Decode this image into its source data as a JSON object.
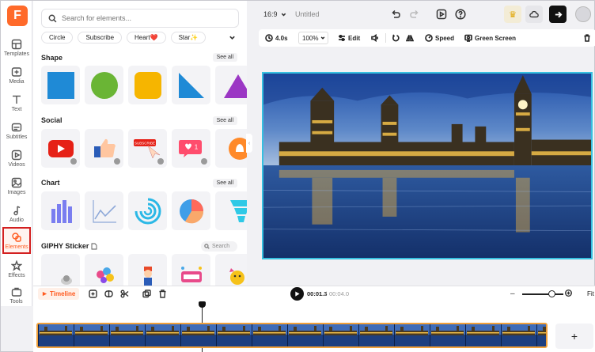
{
  "app": {
    "logo_letter": "F"
  },
  "rail": [
    {
      "label": "Templates",
      "icon": "templates-icon"
    },
    {
      "label": "Media",
      "icon": "media-icon"
    },
    {
      "label": "Text",
      "icon": "text-icon"
    },
    {
      "label": "Subtitles",
      "icon": "subtitles-icon"
    },
    {
      "label": "Videos",
      "icon": "videos-icon"
    },
    {
      "label": "Images",
      "icon": "images-icon"
    },
    {
      "label": "Audio",
      "icon": "audio-icon"
    },
    {
      "label": "Elements",
      "icon": "elements-icon",
      "active": true
    },
    {
      "label": "Effects",
      "icon": "effects-icon"
    },
    {
      "label": "Tools",
      "icon": "tools-icon"
    }
  ],
  "panel": {
    "search_placeholder": "Search for elements...",
    "chips": [
      "Circle",
      "Subscribe",
      "Heart❤️",
      "Star✨"
    ],
    "sections": {
      "shape": {
        "title": "Shape",
        "see_all": "See all"
      },
      "social": {
        "title": "Social",
        "see_all": "See all",
        "notification_count": "1",
        "subscribe_text": "SUBSCRIBE"
      },
      "chart": {
        "title": "Chart",
        "see_all": "See all"
      },
      "giphy": {
        "title": "GIPHY Sticker",
        "search_placeholder": "Search"
      }
    }
  },
  "topbar": {
    "aspect_ratio": "16:9",
    "doc_title": "Untitled"
  },
  "toolbar": {
    "duration": "4.0s",
    "zoom": "100%",
    "edit": "Edit",
    "speed": "Speed",
    "green_screen": "Green Screen"
  },
  "timeline": {
    "label": "Timeline",
    "current_time": "00:01.3",
    "separator": "/",
    "total_time": "00:04.0",
    "fit": "Fit",
    "add": "+",
    "zoom_level": 0.72
  },
  "colors": {
    "accent": "#ff5a1f",
    "canvas_border": "#36c0e0",
    "clip_border": "#f0a03a",
    "active_rail_border": "#d32020"
  }
}
